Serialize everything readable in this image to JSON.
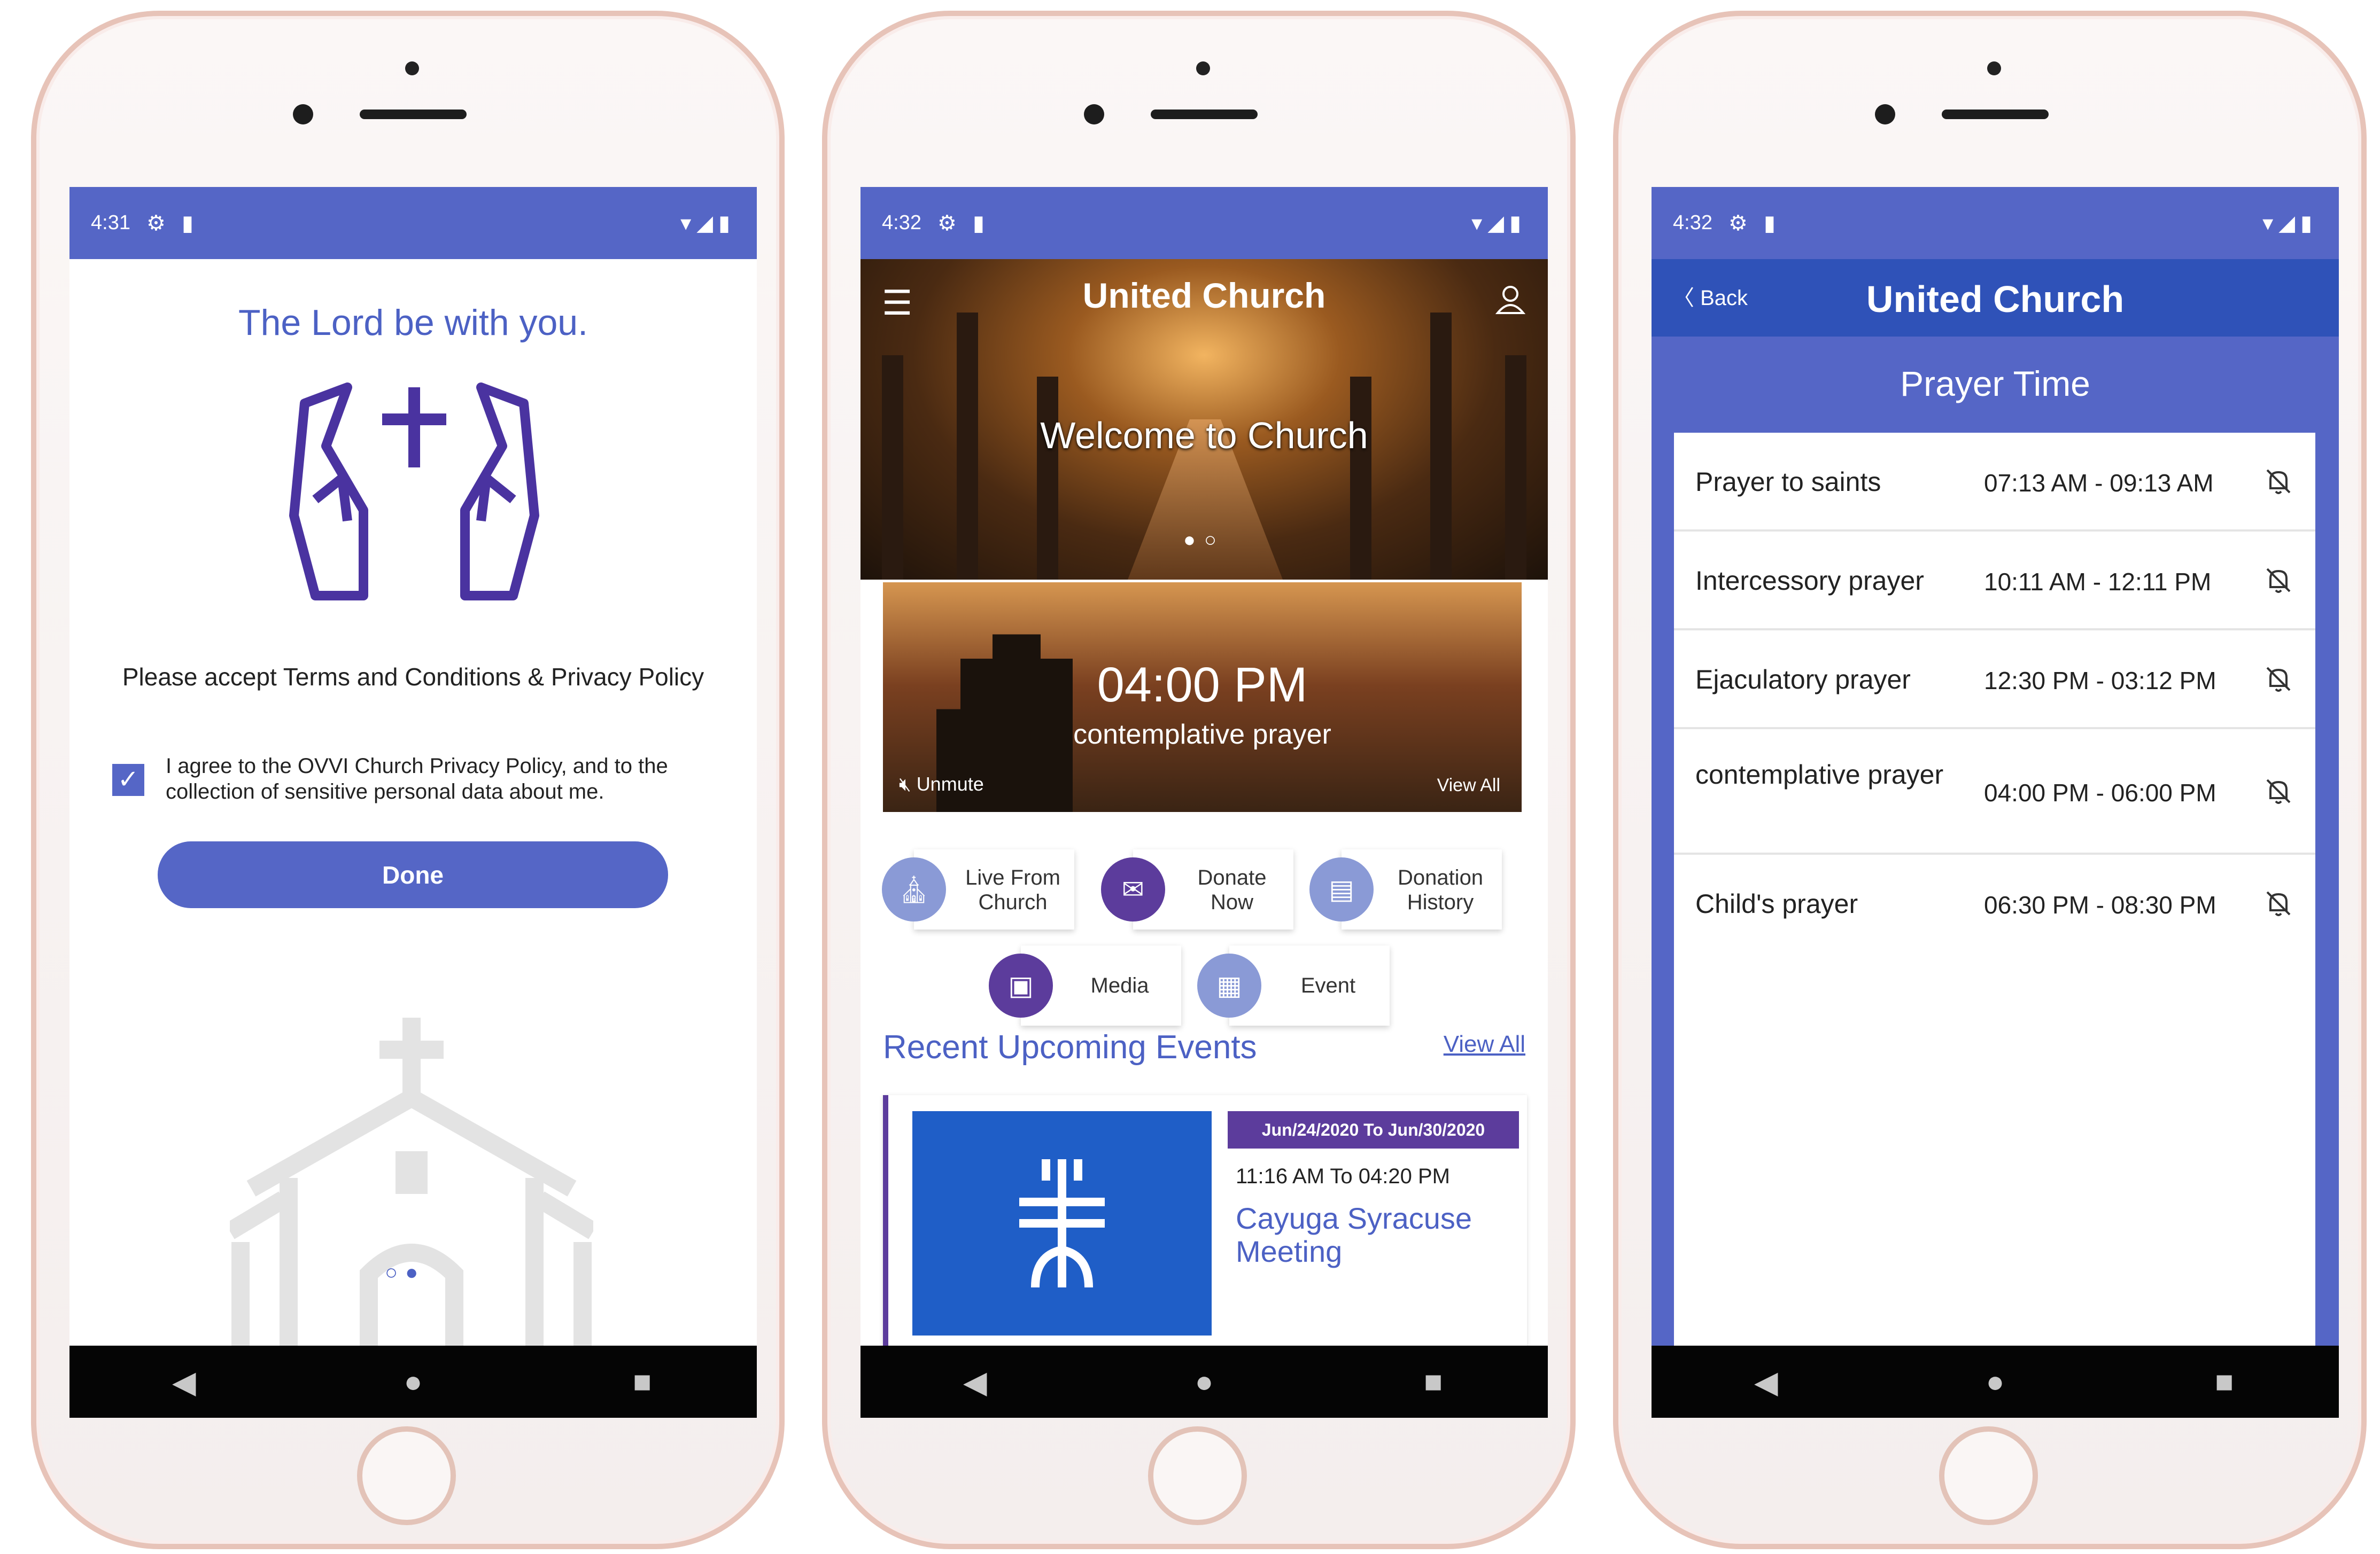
{
  "phone1": {
    "status": {
      "time": "4:31"
    },
    "title": "The Lord be with you.",
    "terms": "Please accept Terms and Conditions & Privacy Policy",
    "agree": "I agree to the OVVI Church Privacy Policy, and to the collection of sensitive personal data about me.",
    "done": "Done",
    "page_dots": "○●"
  },
  "phone2": {
    "status": {
      "time": "4:32"
    },
    "app_title": "United Church",
    "welcome": "Welcome to Church",
    "carousel_dots": "●○",
    "prayer": {
      "time": "04:00 PM",
      "label": "contemplative prayer",
      "unmute": "Unmute",
      "view_all": "View All"
    },
    "actions": [
      {
        "label": "Live From Church"
      },
      {
        "label": "Donate Now"
      },
      {
        "label": "Donation History"
      },
      {
        "label": "Media"
      },
      {
        "label": "Event"
      }
    ],
    "events_title": "Recent Upcoming Events",
    "events_view_all": "View All",
    "event": {
      "date": "Jun/24/2020 To Jun/30/2020",
      "time": "11:16 AM To 04:20 PM",
      "name": "Cayuga Syracuse Meeting"
    }
  },
  "phone3": {
    "status": {
      "time": "4:32"
    },
    "back": "Back",
    "app_title": "United Church",
    "section_title": "Prayer Time",
    "prayers": [
      {
        "name": "Prayer to saints",
        "time": "07:13 AM - 09:13 AM"
      },
      {
        "name": "Intercessory prayer",
        "time": "10:11 AM - 12:11 PM"
      },
      {
        "name": "Ejaculatory prayer",
        "time": "12:30 PM - 03:12 PM"
      },
      {
        "name": "contemplative prayer",
        "time": "04:00 PM - 06:00 PM"
      },
      {
        "name": "Child's prayer",
        "time": "06:30 PM - 08:30 PM"
      }
    ]
  },
  "icons": {
    "status": [
      "gear-icon",
      "sd-card-icon",
      "wifi-icon",
      "signal-icon",
      "battery-icon"
    ],
    "nav": [
      "back-triangle-icon",
      "home-circle-icon",
      "recents-square-icon"
    ],
    "bell_off": "bell-off-icon"
  },
  "colors": {
    "primary": "#5566c6",
    "header_blue": "#2f52b8",
    "accent_purple": "#5c3c9c",
    "event_blue": "#1f5ec7"
  }
}
